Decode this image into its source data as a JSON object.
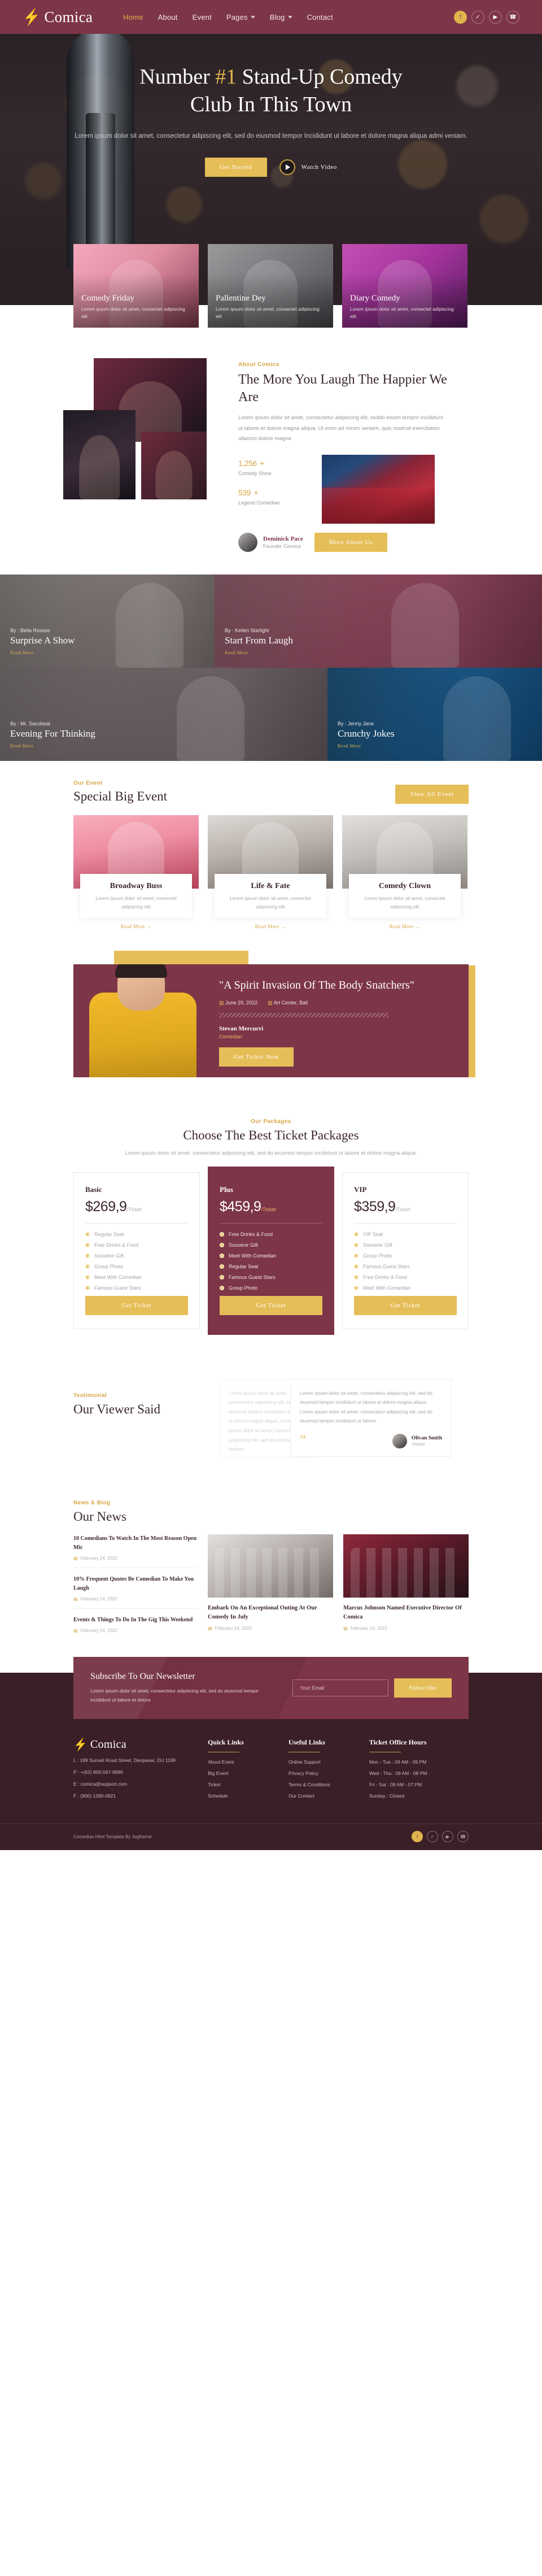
{
  "brand": {
    "name": "Comica",
    "logo_icon": "lightning-bolt-icon"
  },
  "nav": {
    "items": [
      {
        "label": "Home",
        "active": true,
        "caret": false
      },
      {
        "label": "About",
        "active": false,
        "caret": false
      },
      {
        "label": "Event",
        "active": false,
        "caret": false
      },
      {
        "label": "Pages",
        "active": false,
        "caret": true
      },
      {
        "label": "Blog",
        "active": false,
        "caret": true
      },
      {
        "label": "Contact",
        "active": false,
        "caret": false
      }
    ],
    "socials": [
      {
        "name": "facebook-icon",
        "glyph": "f"
      },
      {
        "name": "twitter-icon",
        "glyph": "✓"
      },
      {
        "name": "youtube-icon",
        "glyph": "▶"
      },
      {
        "name": "whatsapp-icon",
        "glyph": "☎"
      }
    ]
  },
  "hero": {
    "title_pre": "Number ",
    "title_highlight": "#1",
    "title_post": " Stand-Up Comedy",
    "title_line2": "Club In This Town",
    "paragraph": "Lorem ipsum dolor sit amet, consectetur adipiscing elit, sed do eiusmod tempor Incididunt ut labore et dolore magna aliqua admi veniam.",
    "cta_primary": "Get Started",
    "cta_video": "Watch Video"
  },
  "feature_cards": [
    {
      "title": "Comedy Friday",
      "text": "Lorem ipsum dolor sit amet, consectet adipiscing elit"
    },
    {
      "title": "Pallentine Dey",
      "text": "Lorem ipsum dolor sit amet, consectet adipiscing elit"
    },
    {
      "title": "Diary Comedy",
      "text": "Lorem ipsum dolor sit amet, consectet adipiscing elit"
    }
  ],
  "about": {
    "eyebrow": "About Comica",
    "title": "The More You Laugh The Happier We Are",
    "paragraph": "Lorem ipsum dolor sit amet, consectetur adipiscing elit, seddo eiusm tempor incididunt ut labore et dolore magna aliqua. Ut enim ad minim veniam, quis nostrud exercitation ullamco dolore magna",
    "stats": [
      {
        "value": "1,256",
        "plus": "+",
        "label": "Comedy Show"
      },
      {
        "value": "539",
        "plus": "+",
        "label": "Legend Comedian"
      }
    ],
    "founder_name": "Dominick Pace",
    "founder_role": "Founder Comica",
    "button": "More About Us"
  },
  "comedians": [
    {
      "by": "By : Bella Rossse",
      "title": "Surprise A Show",
      "more": "Read More"
    },
    {
      "by": "By : Kellen Starlight",
      "title": "Start From Laugh",
      "more": "Read More"
    },
    {
      "by": "By : Mr. Sacobeat",
      "title": "Evening For Thinking",
      "more": "Read More"
    },
    {
      "by": "By : Jenny Jane",
      "title": "Crunchy Jokes",
      "more": "Read More"
    }
  ],
  "events": {
    "eyebrow": "Our Event",
    "title": "Special Big Event",
    "button": "View All Event",
    "cards": [
      {
        "title": "Broadway Buss",
        "text": "Lorem ipsum dolor sit amet, consectet adipiscing elit",
        "more": "Read More →"
      },
      {
        "title": "Life & Fate",
        "text": "Lorem ipsum dolor sit amet, consectet adipiscing elit",
        "more": "Read More →"
      },
      {
        "title": "Comedy Clown",
        "text": "Lorem ipsum dolor sit amet, consectet adipiscing elit",
        "more": "Read More →"
      }
    ]
  },
  "spotlight": {
    "quote": "\"A Spirit Invasion Of The Body Snatchers\"",
    "date": "June 29, 2022",
    "venue": "Art Center, Bali",
    "name": "Stevan Mercurri",
    "role": "Comedian",
    "button": "Get Ticket Now"
  },
  "pricing": {
    "eyebrow": "Our Packages",
    "title": "Choose The Best Ticket Packages",
    "subtitle": "Lorem ipsum dolor sit amet, consectetur adipiscing elit, sed do eiusmod tempor incididunt ut labore et dolore magna aliqua.",
    "plans": [
      {
        "name": "Basic",
        "price": "$269,9",
        "per": "/Ticket",
        "featured": false,
        "features": [
          "Regular Seat",
          "Free Drinks & Food",
          "Souvenir Gift",
          "Group Photo",
          "Meet With Comedian",
          "Famous Guest Stars"
        ],
        "button": "Get Ticket"
      },
      {
        "name": "Plus",
        "price": "$459,9",
        "per": "/Ticket",
        "featured": true,
        "features": [
          "Free Drinks & Food",
          "Souvenir Gift",
          "Meet With Comedian",
          "Regular Seat",
          "Famous Guest Stars",
          "Group Photo"
        ],
        "button": "Get Ticket"
      },
      {
        "name": "VIP",
        "price": "$359,9",
        "per": "/Ticket",
        "featured": false,
        "features": [
          "VIP Seat",
          "Souvenir Gift",
          "Group Photo",
          "Famous Guest Stars",
          "Free Drinks & Food",
          "Meet With Comedian"
        ],
        "button": "Get Ticket"
      }
    ]
  },
  "testimonial": {
    "eyebrow": "Testimonial",
    "title": "Our Viewer Said",
    "ghost_text": "Lorem ipsum dolor sit amet, consectetur adipiscing elit, sed do eiusmod tempor incididunt ut labore et dolore magna aliqua. Lorem ipsum dolor sit amet, consectetur adipiscing elit, sed do eiusmod tempor",
    "main_text": "Lorem ipsum dolor sit amet, consectetur adipiscing elit, sed do eiusmod tempor incididunt ut labore et dolore magna aliqua. Lorem ipsum dolor sit amet, consectetur adipiscing elit, sed do eiusmod tempor incididunt ut labore.",
    "quote_icon": "”",
    "author_name": "Olivan Smith",
    "author_role": "Viewer"
  },
  "news": {
    "eyebrow": "News & Blog",
    "title": "Our News",
    "list": [
      {
        "title": "10 Comedians To Watch In The Most Reason Open Mic",
        "date": "February 24, 2022"
      },
      {
        "title": "10% Frequent Quotes Be Comedian To Make You Laugh",
        "date": "February 24, 2022"
      },
      {
        "title": "Events & Things To Do In The Gig This Weekend",
        "date": "February 24, 2022"
      }
    ],
    "posts": [
      {
        "title": "Embark On An Exceptional Outing At Our Comedy In July",
        "date": "February 24, 2022"
      },
      {
        "title": "Marcus Johnson Named Executive Director Of Comica",
        "date": "February 24, 2022"
      }
    ]
  },
  "newsletter": {
    "title": "Subscribe To Our Newsletter",
    "text": "Lorem ipsum dolor sit amet, consectetur adipiscing elit, sed do eiusmod tempor incididunt ut labore et dolore",
    "placeholder": "Your Email",
    "button": "Subscribe"
  },
  "footer": {
    "contact": [
      "L : 189 Sunset Road Street, Denpasar, DU 1199",
      "P : +(62) 800-567-8990",
      "E : comica@support.com",
      "F : (900) 1280-0821"
    ],
    "quick_links": {
      "title": "Quick Links",
      "items": [
        "About Event",
        "Big Event",
        "Ticket",
        "Schedule"
      ]
    },
    "useful_links": {
      "title": "Useful Links",
      "items": [
        "Online Support",
        "Privacy Policy",
        "Terms & Conditions",
        "Our Contact"
      ]
    },
    "hours": {
      "title": "Ticket Office Hours",
      "items": [
        "Mon - Tue : 09 AM - 09 PM",
        "Wed - Thu : 09 AM - 08 PM",
        "Fri - Sat : 09 AM - 07 PM",
        "Sunday : Closed"
      ]
    },
    "copyright": "Comedian Html Template By Jegtheme",
    "socials": [
      {
        "name": "facebook-icon",
        "glyph": "f"
      },
      {
        "name": "twitter-icon",
        "glyph": "✓"
      },
      {
        "name": "youtube-icon",
        "glyph": "▶"
      },
      {
        "name": "whatsapp-icon",
        "glyph": "☎"
      }
    ]
  },
  "colors": {
    "brand": "#7d3548",
    "accent": "#e6be58",
    "dark": "#3b1f27"
  }
}
